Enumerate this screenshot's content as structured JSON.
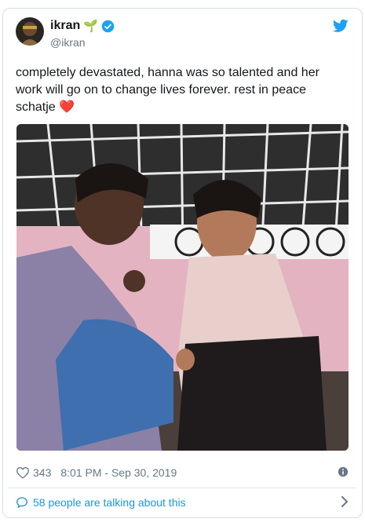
{
  "tweet": {
    "author_name": "ikran",
    "author_emoji": "🌱",
    "handle": "@ikran",
    "text": "completely devastated, hanna was so talented and her work will go on to change lives forever. rest in peace schatje",
    "text_emoji": "❤️",
    "likes": "343",
    "timestamp": "8:01 PM - Sep 30, 2019",
    "footer_text": "58 people are talking about this"
  },
  "colors": {
    "twitter_blue": "#1da1f2",
    "link_blue": "#1b95e0",
    "text": "#14171a",
    "muted": "#657786"
  },
  "icons": [
    "twitter-bird-icon",
    "verified-badge-icon",
    "heart-icon",
    "info-icon",
    "speech-bubble-icon",
    "chevron-right-icon"
  ]
}
